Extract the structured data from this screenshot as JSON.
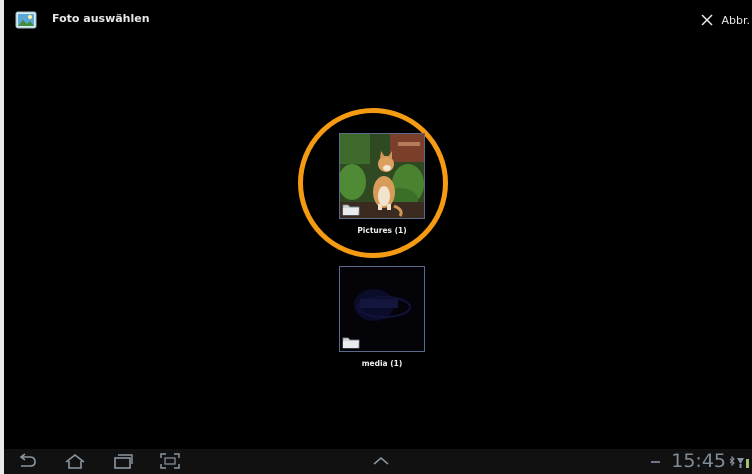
{
  "header": {
    "title": "Foto auswählen",
    "cancel_label": "Abbr.",
    "app_icon": "gallery-icon",
    "cancel_icon": "close-icon"
  },
  "albums": [
    {
      "label": "Pictures (1)",
      "thumbnail": "cat-photo",
      "icon": "folder-icon",
      "highlighted": true
    },
    {
      "label": "media (1)",
      "thumbnail": "dark-logo",
      "icon": "folder-icon",
      "highlighted": false
    }
  ],
  "highlight_color": "#f49a13",
  "navbar": {
    "buttons": [
      "back-icon",
      "home-icon",
      "recent-apps-icon",
      "screenshot-icon",
      "expand-up-icon"
    ],
    "time": "15:45",
    "status_icons": [
      "bluetooth-icon",
      "wifi-icon",
      "battery-icon"
    ]
  }
}
